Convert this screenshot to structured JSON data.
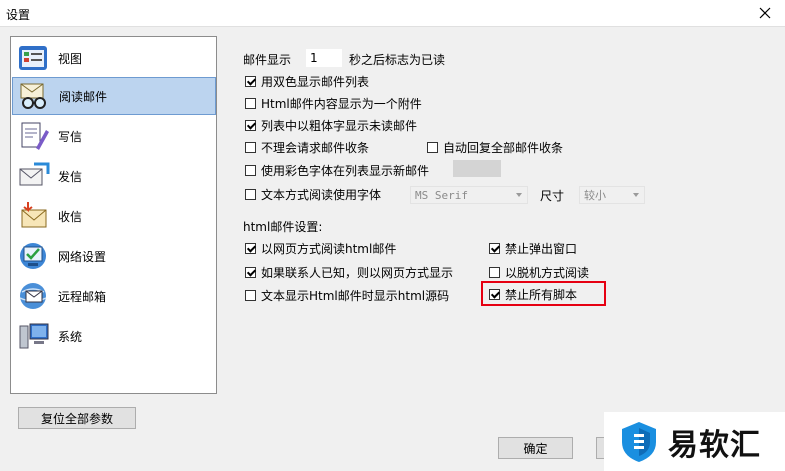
{
  "window": {
    "title": "设置"
  },
  "sidebar": {
    "items": [
      {
        "label": "视图",
        "icon": "view-icon"
      },
      {
        "label": "阅读邮件",
        "icon": "read-mail-icon",
        "active": true
      },
      {
        "label": "写信",
        "icon": "compose-icon"
      },
      {
        "label": "发信",
        "icon": "send-icon"
      },
      {
        "label": "收信",
        "icon": "receive-icon"
      },
      {
        "label": "网络设置",
        "icon": "network-icon"
      },
      {
        "label": "远程邮箱",
        "icon": "remote-mailbox-icon"
      },
      {
        "label": "系统",
        "icon": "system-icon"
      }
    ]
  },
  "main": {
    "mark_read": {
      "prefix": "邮件显示",
      "value": "1",
      "suffix": "秒之后标志为已读"
    },
    "options": [
      {
        "label": "用双色显示邮件列表",
        "checked": true
      },
      {
        "label": "Html邮件内容显示为一个附件",
        "checked": false
      },
      {
        "label": "列表中以粗体字显示未读邮件",
        "checked": true
      },
      {
        "label": "不理会请求邮件收条",
        "checked": false
      },
      {
        "label": "自动回复全部邮件收条",
        "checked": false
      },
      {
        "label": "使用彩色字体在列表显示新邮件",
        "checked": false
      },
      {
        "label": "文本方式阅读使用字体",
        "checked": false
      }
    ],
    "font_select": {
      "value": "MS Serif"
    },
    "size_label": "尺寸",
    "size_select": {
      "value": "较小"
    },
    "html_section_label": "html邮件设置:",
    "html_options": [
      {
        "label": "以网页方式阅读html邮件",
        "checked": true
      },
      {
        "label": "如果联系人已知，则以网页方式显示",
        "checked": true
      },
      {
        "label": "文本显示Html邮件时显示html源码",
        "checked": false
      },
      {
        "label": "禁止弹出窗口",
        "checked": true
      },
      {
        "label": "以脱机方式阅读",
        "checked": false
      },
      {
        "label": "禁止所有脚本",
        "checked": true
      }
    ]
  },
  "buttons": {
    "reset": "复位全部参数",
    "ok": "确定"
  },
  "watermark": {
    "text": "易软汇"
  },
  "colors": {
    "accent_highlight": "#e60012",
    "active_nav_bg": "#bcd4ef",
    "swatch": "#d4d4d4"
  }
}
